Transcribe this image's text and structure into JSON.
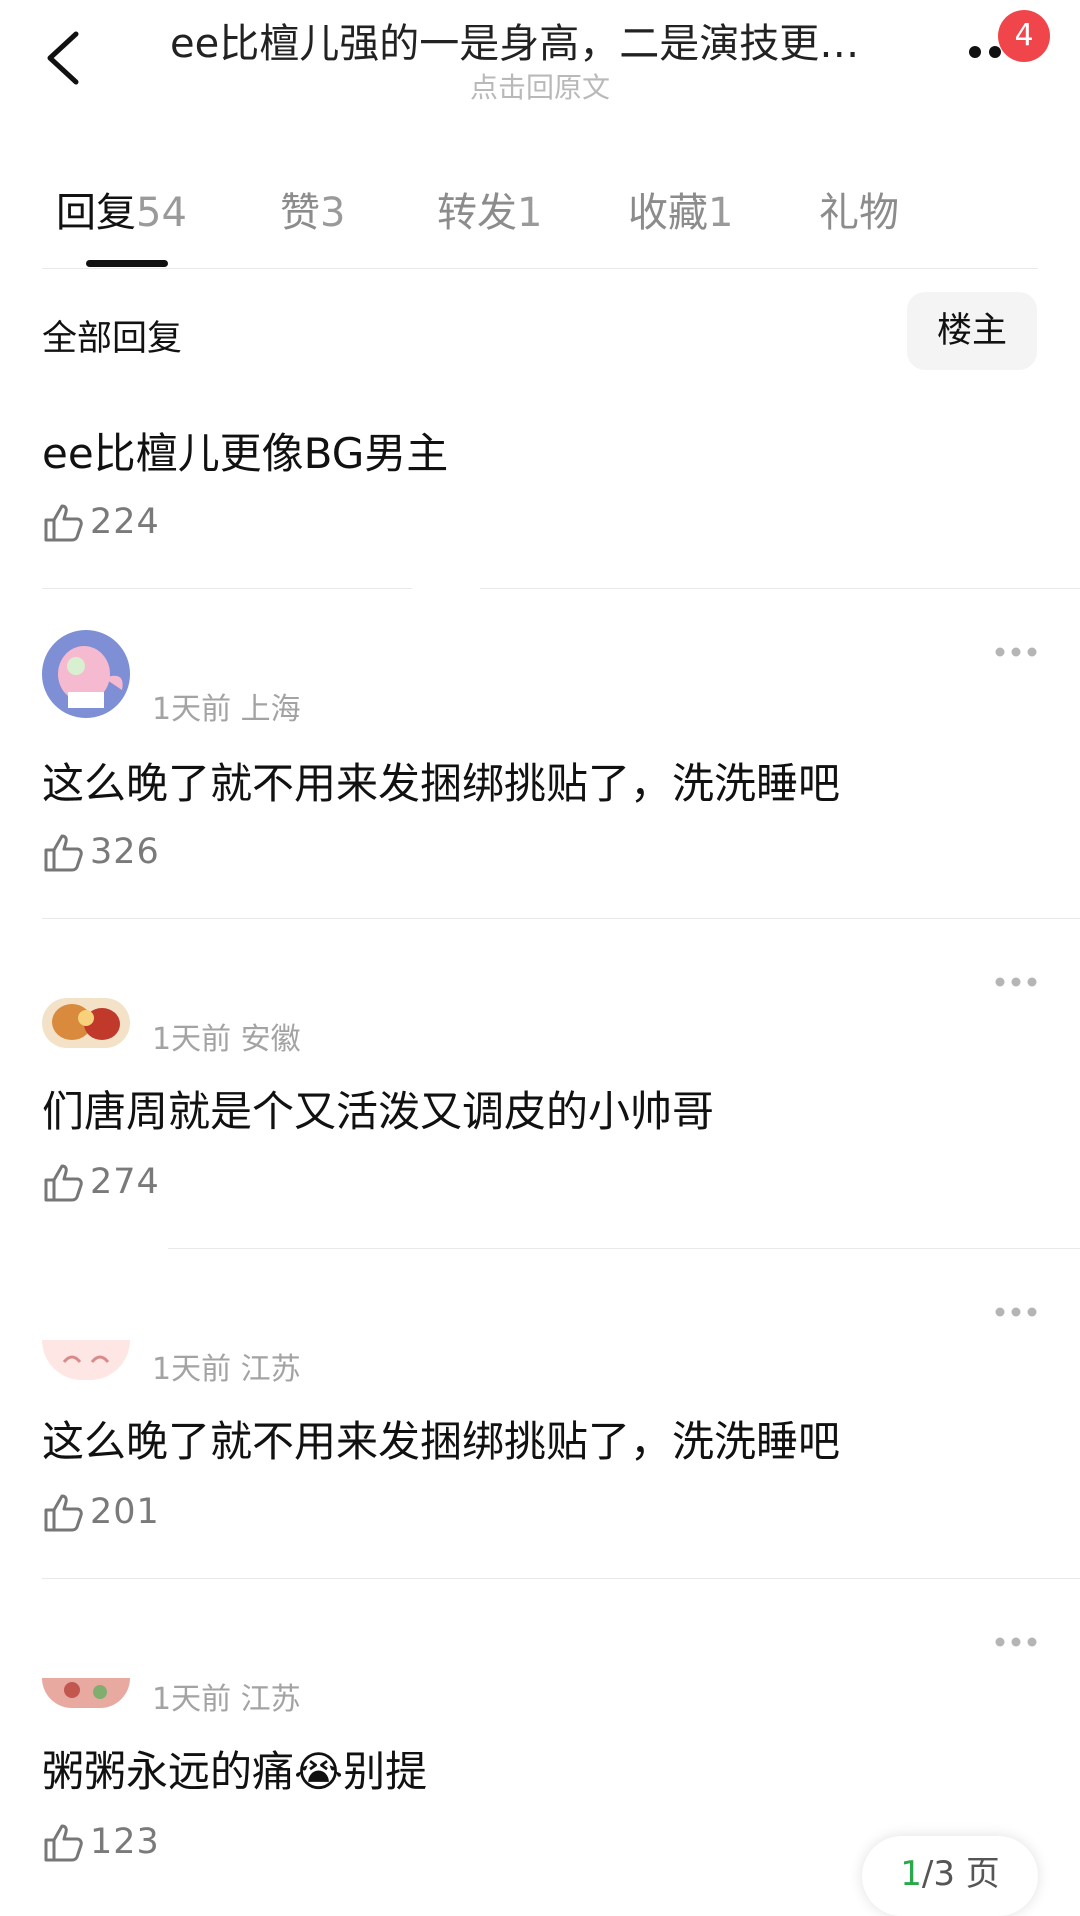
{
  "header": {
    "title": "ee比檀儿强的一是身高，二是演技更…",
    "subtitle": "点击回原文",
    "notification_count": "4"
  },
  "tabs": [
    {
      "label": "回复",
      "count": "54",
      "active": true
    },
    {
      "label": "赞",
      "count": "3"
    },
    {
      "label": "转发",
      "count": "1"
    },
    {
      "label": "收藏",
      "count": "1"
    },
    {
      "label": "礼物",
      "count": ""
    }
  ],
  "section": {
    "title": "全部回复",
    "op_button": "楼主"
  },
  "first_reply": {
    "text": "ee比檀儿更像BG男主",
    "likes": "224"
  },
  "comments": [
    {
      "time_location": "1天前 上海",
      "text": "这么晚了就不用来发捆绑挑贴了，洗洗睡吧",
      "likes": "326"
    },
    {
      "time_location": "1天前 安徽",
      "text": "们唐周就是个又活泼又调皮的小帅哥",
      "likes": "274"
    },
    {
      "time_location": "1天前 江苏",
      "text": "这么晚了就不用来发捆绑挑贴了，洗洗睡吧",
      "likes": "201"
    },
    {
      "time_location": "1天前 江苏",
      "text": "粥粥永远的痛😭别提",
      "likes": "123"
    }
  ],
  "pager": {
    "current": "1",
    "total_label": "/3 页"
  },
  "colors": {
    "badge": "#f0454a",
    "pager_current": "#2aa84a"
  }
}
